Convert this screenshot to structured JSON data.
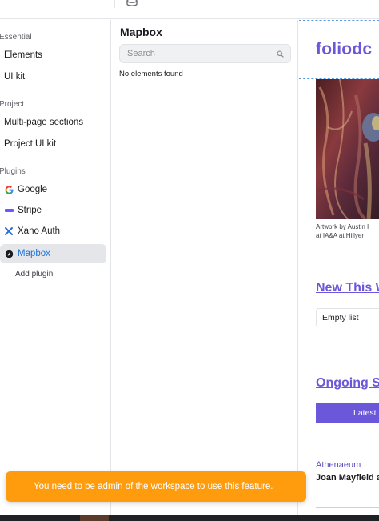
{
  "sidebar": {
    "sections": [
      {
        "label": "Essential",
        "items": [
          {
            "label": "Elements"
          },
          {
            "label": "UI kit"
          }
        ]
      },
      {
        "label": "Project",
        "items": [
          {
            "label": "Multi-page sections"
          },
          {
            "label": "Project UI kit"
          }
        ]
      },
      {
        "label": "Plugins",
        "items": [
          {
            "label": "Google",
            "icon": "google-icon"
          },
          {
            "label": "Stripe",
            "icon": "stripe-icon"
          },
          {
            "label": "Xano Auth",
            "icon": "xano-icon"
          },
          {
            "label": "Mapbox",
            "icon": "mapbox-icon",
            "active": true
          }
        ]
      }
    ],
    "add_plugin_label": "Add plugin"
  },
  "panel": {
    "title": "Mapbox",
    "search_placeholder": "Search",
    "empty_message": "No elements found"
  },
  "canvas": {
    "logo_text": "foliodc",
    "caption_line1": "Artwork by Austin I",
    "caption_line2": "at IA&A at Hillyer",
    "new_heading": "New This W",
    "empty_list_label": "Empty list",
    "ongoing_heading": "Ongoing S",
    "latest_button_label": "Latest",
    "venue": "Athenaeum",
    "artist": "Joan Mayfield a"
  },
  "toast": {
    "message": "You need to be admin of the workspace to use this feature.",
    "color": "#ff9c0e"
  },
  "colors": {
    "accent": "#6b57d9",
    "active_blue": "#1d74d9"
  }
}
